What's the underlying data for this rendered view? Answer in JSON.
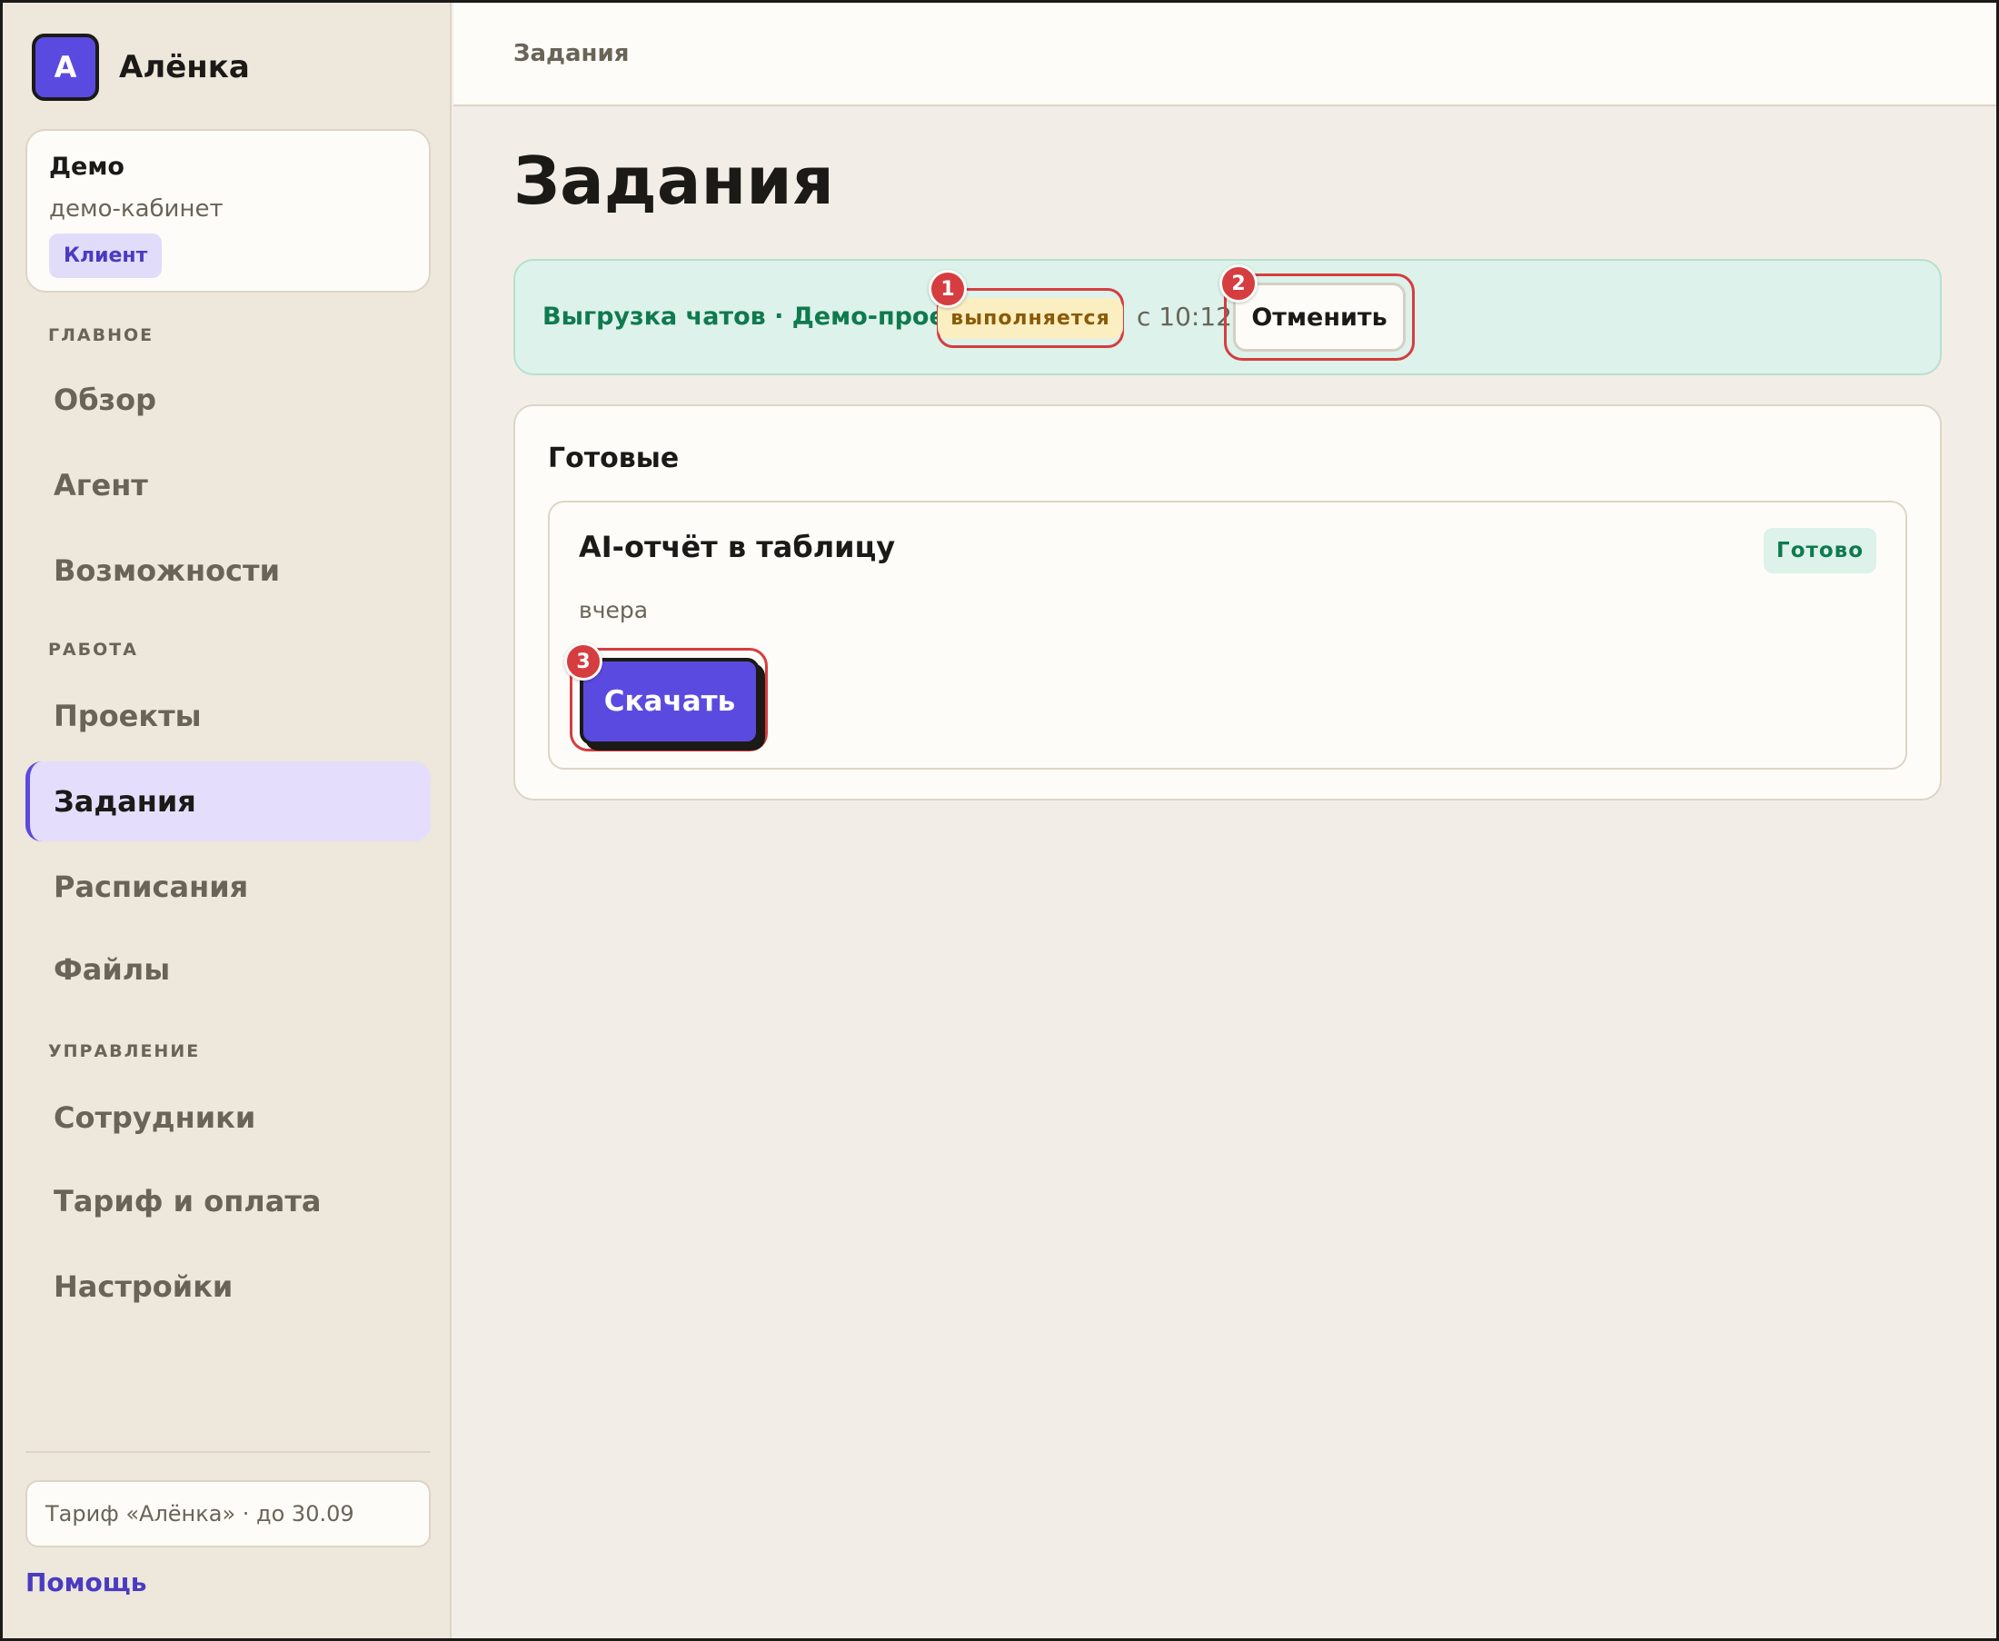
{
  "brand": {
    "logo_letter": "A",
    "name": "Алёнка"
  },
  "account": {
    "name": "Демо",
    "subtitle": "демо-кабинет",
    "role_badge": "Клиент"
  },
  "sidebar": {
    "sections": [
      {
        "label": "ГЛАВНОЕ",
        "items": [
          {
            "label": "Обзор",
            "active": false
          },
          {
            "label": "Агент",
            "active": false
          },
          {
            "label": "Возможности",
            "active": false
          }
        ]
      },
      {
        "label": "РАБОТА",
        "items": [
          {
            "label": "Проекты",
            "active": false
          },
          {
            "label": "Задания",
            "active": true
          },
          {
            "label": "Расписания",
            "active": false
          },
          {
            "label": "Файлы",
            "active": false
          }
        ]
      },
      {
        "label": "УПРАВЛЕНИЕ",
        "items": [
          {
            "label": "Сотрудники",
            "active": false
          },
          {
            "label": "Тариф и оплата",
            "active": false
          },
          {
            "label": "Настройки",
            "active": false
          }
        ]
      }
    ],
    "plan_text": "Тариф «Алёнка» · до 30.09",
    "help_link": "Помощь"
  },
  "topbar": {
    "breadcrumb": "Задания"
  },
  "main": {
    "title": "Задания",
    "running_task": {
      "title": "Выгрузка чатов · Демо-проект",
      "status": "выполняется",
      "time": "с 10:12",
      "cancel_label": "Отменить"
    },
    "done_section": {
      "heading": "Готовые",
      "tasks": [
        {
          "title": "AI-отчёт в таблицу",
          "status": "Готово",
          "time": "вчера",
          "download_label": "Скачать"
        }
      ]
    }
  },
  "markers": [
    "1",
    "2",
    "3"
  ],
  "colors": {
    "accent": "#5b4ae0",
    "running_text": "#0f7a4e",
    "running_bg": "#dcf2ea",
    "status_running_bg": "#fbeec0",
    "marker": "#d63d40"
  }
}
